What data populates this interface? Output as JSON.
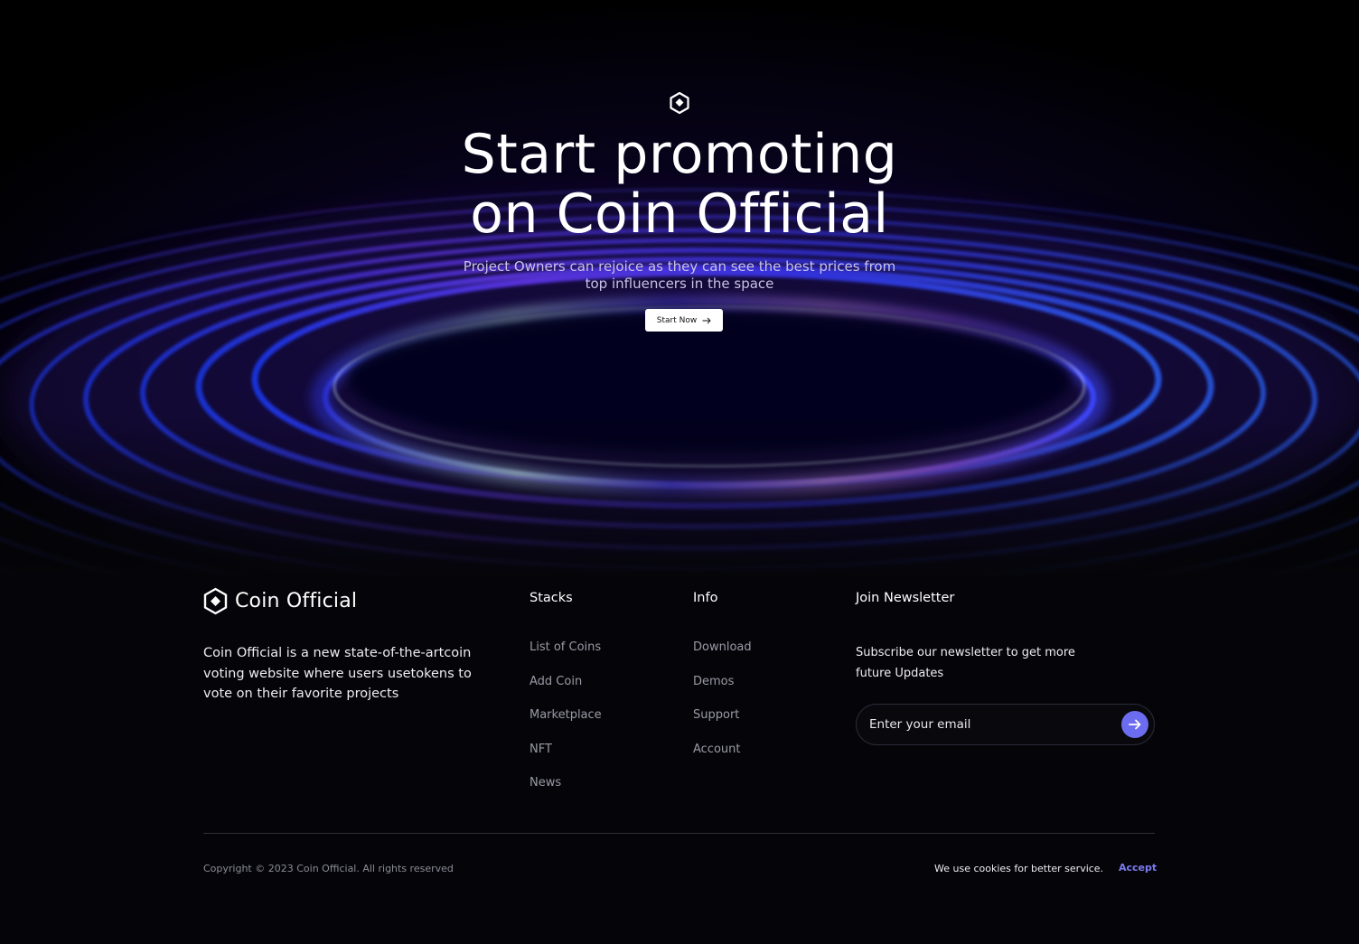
{
  "hero": {
    "title_line1": "Start promoting",
    "title_line2": "on Coin Official",
    "subtitle_line1": "Project Owners can rejoice as they can see the best prices from",
    "subtitle_line2": "top influencers in the space",
    "cta_label": "Start Now",
    "cta_icon": "arrow-right-icon",
    "logo_icon": "hexagon-coin-icon"
  },
  "footer": {
    "brand": {
      "name": "Coin Official",
      "icon": "hexagon-coin-icon",
      "description": "Coin Official is a new state-of-the-artcoin voting website where users usetokens to vote on their favorite projects"
    },
    "columns": [
      {
        "title": "Stacks",
        "items": [
          "List of Coins",
          "Add Coin",
          "Marketplace",
          "NFT",
          "News"
        ]
      },
      {
        "title": "Info",
        "items": [
          "Download",
          "Demos",
          "Support",
          "Account"
        ]
      }
    ],
    "newsletter": {
      "title": "Join Newsletter",
      "text": "Subscribe our newsletter to get more future Updates",
      "placeholder": "Enter your email",
      "submit_icon": "arrow-right-icon"
    },
    "copyright": "Copyright © 2023 Coin Official. All rights reserved",
    "cookie_text": "We use cookies for better service.",
    "accept_label": "Accept"
  },
  "colors": {
    "background": "#050509",
    "accent": "#6c6cf0",
    "accept_link": "#7b7bf4",
    "muted_text": "#9a9aa6",
    "ring_blue": "#3a7bff",
    "ring_violet": "#8a3cff"
  }
}
